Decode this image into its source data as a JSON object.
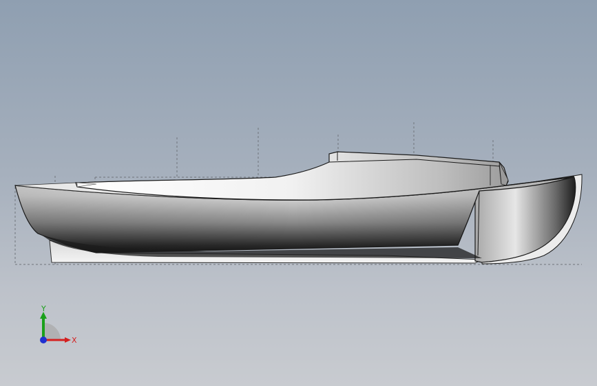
{
  "viewport": {
    "background_top": "#8f9fb1",
    "background_bottom": "#c8cbd0"
  },
  "model": {
    "description_icon": "boat-hull-model",
    "hull_color": "#e4e4e4",
    "edge_color": "#2a2a2a",
    "sketch_line_color": "#6f747b"
  },
  "triad": {
    "x_label": "X",
    "y_label": "Y",
    "x_color": "#d42020",
    "y_color": "#1aa01a",
    "z_color": "#2030d0"
  }
}
